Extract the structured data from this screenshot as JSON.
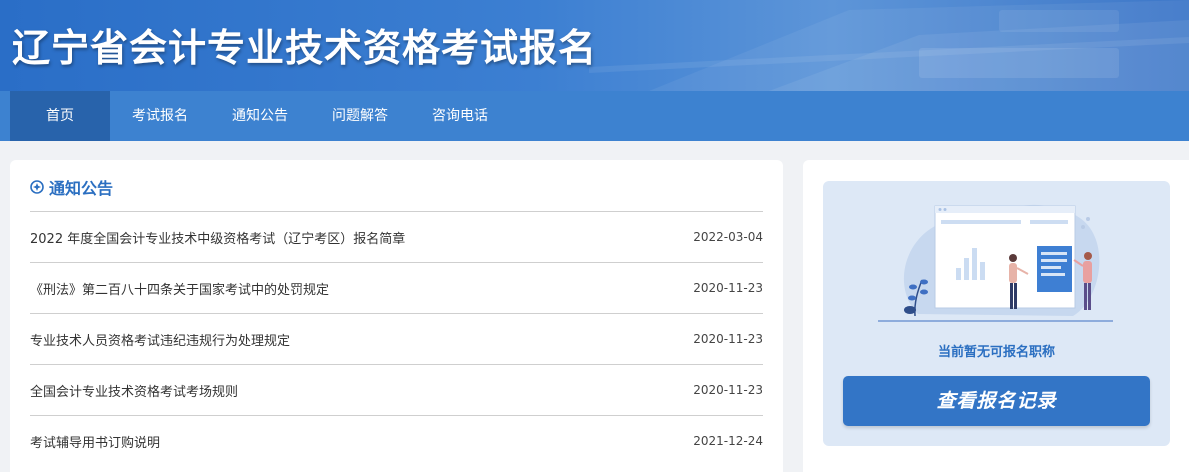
{
  "header": {
    "title": "辽宁省会计专业技术资格考试报名"
  },
  "nav": {
    "items": [
      {
        "label": "首页"
      },
      {
        "label": "考试报名"
      },
      {
        "label": "通知公告"
      },
      {
        "label": "问题解答"
      },
      {
        "label": "咨询电话"
      }
    ],
    "active_index": 0
  },
  "notices": {
    "title": "通知公告",
    "icon": "compass-icon",
    "items": [
      {
        "title": "2022 年度全国会计专业技术中级资格考试（辽宁考区）报名简章",
        "date": "2022-03-04"
      },
      {
        "title": "《刑法》第二百八十四条关于国家考试中的处罚规定",
        "date": "2020-11-23"
      },
      {
        "title": "专业技术人员资格考试违纪违规行为处理规定",
        "date": "2020-11-23"
      },
      {
        "title": "全国会计专业技术资格考试考场规则",
        "date": "2020-11-23"
      },
      {
        "title": "考试辅导用书订购说明",
        "date": "2021-12-24"
      }
    ]
  },
  "sidebar": {
    "status_text": "当前暂无可报名职称",
    "button_label": "查看报名记录"
  },
  "colors": {
    "nav_bg": "#3d82d0",
    "nav_active": "#2863ab",
    "accent": "#2b6fc1",
    "button": "#3375c6"
  }
}
